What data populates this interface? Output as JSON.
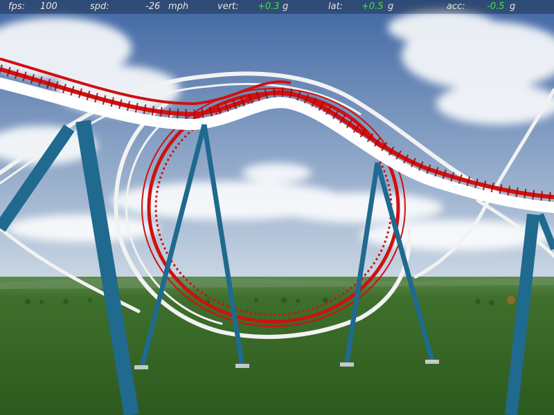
{
  "hud": {
    "fps": {
      "label": "fps:",
      "value": "100"
    },
    "spd": {
      "label": "spd:",
      "value": "-26",
      "unit": "mph"
    },
    "vert": {
      "label": "vert:",
      "value": "+0.3",
      "unit": "g"
    },
    "lat": {
      "label": "lat:",
      "value": "+0.5",
      "unit": "g"
    },
    "acc": {
      "label": "acc:",
      "value": "-0.5",
      "unit": "g"
    }
  },
  "colors": {
    "sky_top": "#4a6ea8",
    "sky_bottom": "#b9c9da",
    "ground": "#3d6a2a",
    "red_track": "#d01010",
    "white_track": "#f2f2f2",
    "support": "#1f6a8e",
    "gforce_value": "#3ee63e"
  }
}
